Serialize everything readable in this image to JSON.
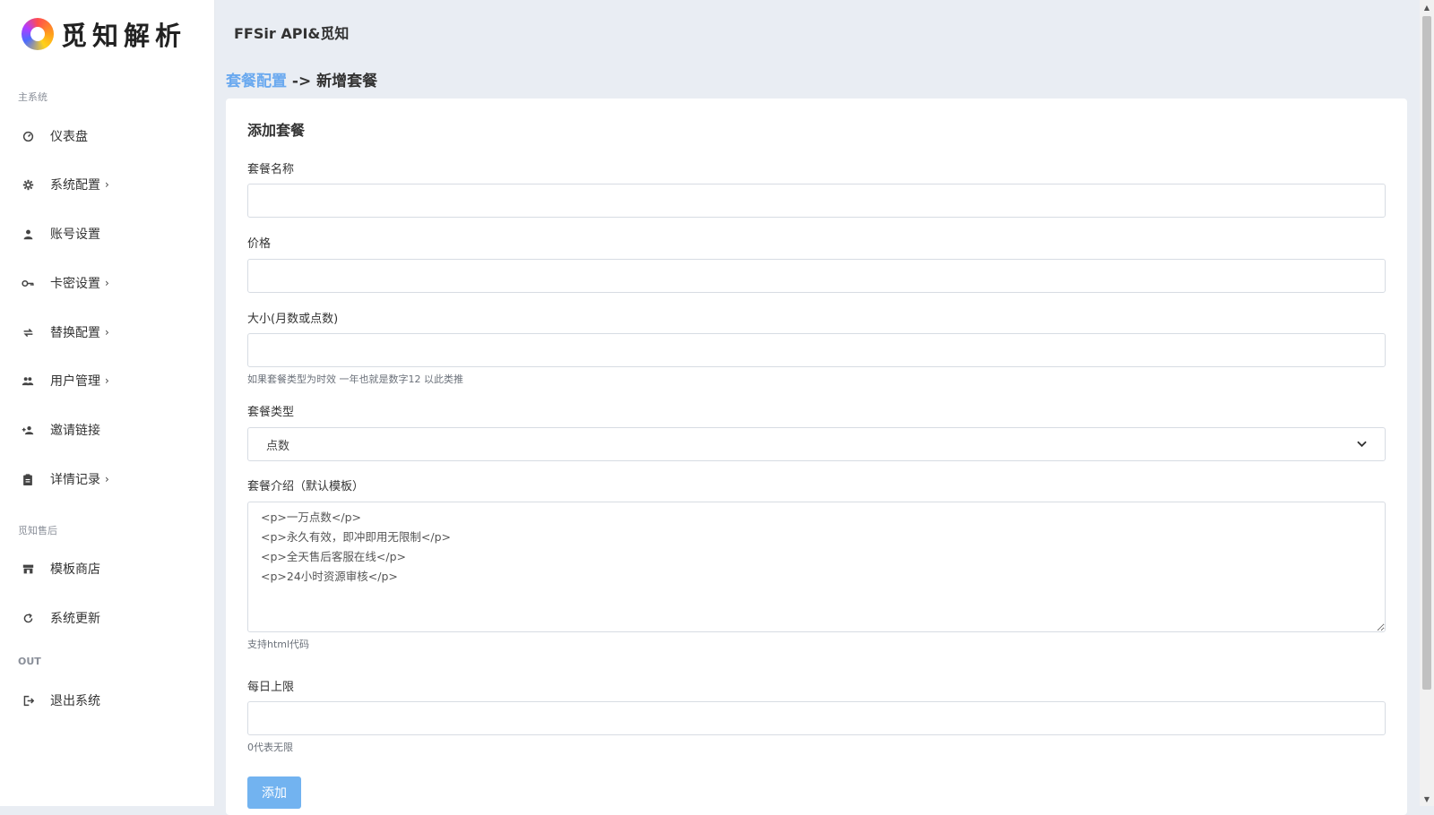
{
  "sidebar": {
    "logo_text": "觅知解析",
    "sections": {
      "main": "主系统",
      "after_sales": "觅知售后",
      "out": "OUT"
    },
    "items": [
      {
        "label": "仪表盘",
        "icon": "gauge-icon",
        "has_children": false
      },
      {
        "label": "系统配置",
        "icon": "gear-icon",
        "has_children": true
      },
      {
        "label": "账号设置",
        "icon": "user-icon",
        "has_children": false
      },
      {
        "label": "卡密设置",
        "icon": "key-icon",
        "has_children": true
      },
      {
        "label": "替换配置",
        "icon": "swap-icon",
        "has_children": true
      },
      {
        "label": "用户管理",
        "icon": "users-icon",
        "has_children": true
      },
      {
        "label": "邀请链接",
        "icon": "user-add-icon",
        "has_children": false
      },
      {
        "label": "详情记录",
        "icon": "clipboard-icon",
        "has_children": true
      },
      {
        "label": "模板商店",
        "icon": "store-icon",
        "has_children": false
      },
      {
        "label": "系统更新",
        "icon": "refresh-icon",
        "has_children": false
      },
      {
        "label": "退出系统",
        "icon": "logout-icon",
        "has_children": false
      }
    ]
  },
  "header": {
    "title": "FFSir API&觅知"
  },
  "breadcrumb": {
    "parent": "套餐配置",
    "separator": " -> ",
    "current": "新增套餐"
  },
  "form": {
    "title": "添加套餐",
    "name_label": "套餐名称",
    "name_value": "",
    "price_label": "价格",
    "price_value": "",
    "size_label": "大小(月数或点数)",
    "size_value": "",
    "size_help": "如果套餐类型为时效 一年也就是数字12 以此类推",
    "type_label": "套餐类型",
    "type_selected": "点数",
    "intro_label": "套餐介绍（默认模板）",
    "intro_value": "<p>一万点数</p>\n<p>永久有效，即冲即用无限制</p>\n<p>全天售后客服在线</p>\n<p>24小时资源审核</p>",
    "intro_help": "支持html代码",
    "daily_label": "每日上限",
    "daily_value": "",
    "daily_help": "0代表无限",
    "submit_label": "添加"
  },
  "colors": {
    "accent": "#72b3f0",
    "link": "#6aa9ef",
    "background": "#e9edf3"
  }
}
